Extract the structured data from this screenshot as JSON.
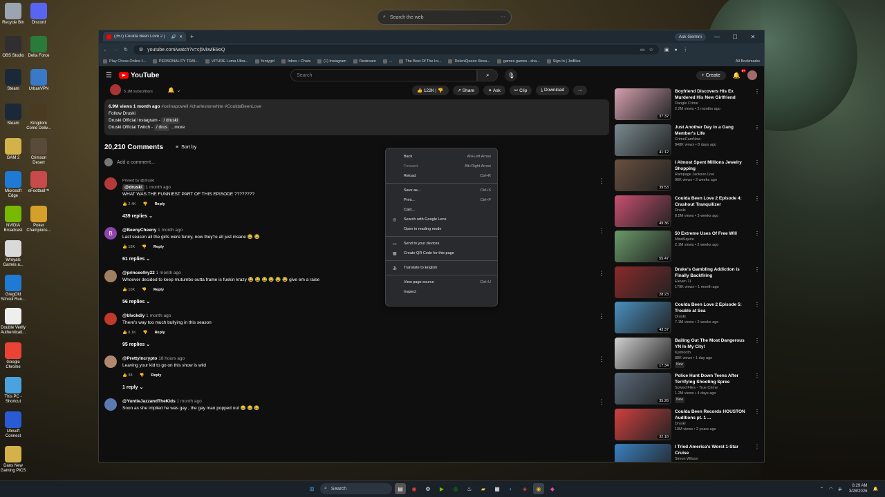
{
  "desktop": {
    "icons": [
      {
        "label": "Recycle Bin",
        "color": "#9aa5b1"
      },
      {
        "label": "Discord",
        "color": "#5865f2"
      },
      {
        "label": "OBS Studio",
        "color": "#302e31"
      },
      {
        "label": "Delta Force",
        "color": "#2a7a3a"
      },
      {
        "label": "Steam",
        "color": "#1b2838"
      },
      {
        "label": "UrbanVPN",
        "color": "#3a78c8"
      },
      {
        "label": "Steam",
        "color": "#1b2838"
      },
      {
        "label": "Kingdom Come Deliv...",
        "color": "#4a3a22"
      },
      {
        "label": "GAM 2",
        "color": "#d4b24a"
      },
      {
        "label": "Crimson Desert",
        "color": "#5a4a3a"
      },
      {
        "label": "Microsoft Edge",
        "color": "#1f7ad6"
      },
      {
        "label": "eFootball™",
        "color": "#c84a4a"
      },
      {
        "label": "NVIDIA Broadcast",
        "color": "#76b900"
      },
      {
        "label": "Poker Champions...",
        "color": "#d4a02a"
      },
      {
        "label": "Wroyals Games a...",
        "color": "#d9d9d9"
      },
      {
        "label": "GregOld School Run...",
        "color": "#1f7ad6"
      },
      {
        "label": "Double Verify Authenticati...",
        "color": "#eeeeee"
      },
      {
        "label": "Google Chrome",
        "color": "#ea4335"
      },
      {
        "label": "This PC - Shortcut",
        "color": "#4aa3df"
      },
      {
        "label": "Ubisoft Connect",
        "color": "#2a5bd7"
      },
      {
        "label": "Dans New Gaming PICS",
        "color": "#d4b24a"
      }
    ],
    "search_placeholder": "Search the web"
  },
  "browser": {
    "tab_title": "(357) Coulda Been Love 2 |",
    "ask_gemini": "Ask Gemini",
    "url": "youtube.com/watch?v=cj5vkwlE9oQ",
    "bookmarks": [
      "Play Chess Online f...",
      "PERSONALITY TRAI...",
      "VITURE Luma Ultra...",
      "fentygirl",
      "Inbox • Chats",
      "(1) Instagram",
      "Restream",
      "...",
      "The Best Of The Ini...",
      "DeleniQueen Strea...",
      "games games - sha...",
      "Sign In | JetBlue"
    ],
    "all_bookmarks": "All Bookmarks"
  },
  "youtube": {
    "logo": "YouTube",
    "search_placeholder": "Search",
    "create": "Create",
    "notif_count": "9+",
    "channel_subs": "5.1M subscribers",
    "like_count": "122K",
    "actions": {
      "share": "Share",
      "ask": "Ask",
      "clip": "Clip",
      "download": "Download"
    },
    "description": {
      "views": "6.9M views",
      "age": "1 month ago",
      "tags": "#celinapowell #charlestonwhite #CouldaBeenLove",
      "line1": "Follow Druski",
      "line2": "Druski Official Instagram -",
      "line2_link": "/ druski",
      "line3": "Druski Official Twitch -",
      "line3_link": "/ drus",
      "more": "...more"
    },
    "comments_count": "20,210 Comments",
    "sort_by": "Sort by",
    "add_comment": "Add a comment...",
    "comments": [
      {
        "pinned": "Pinned by @druski",
        "handle": "@druski",
        "time": "1 month ago",
        "text": "WHAT WAS THE FUNNIEST PART OF THIS EPISODE ????????",
        "likes": "2.4K",
        "reply": "Reply",
        "replies": "439 replies",
        "color": "#b33a3a"
      },
      {
        "handle": "@BeenyCheeny",
        "time": "1 month ago",
        "text": "Last season all the girls were funny, now they're all just insane 😂 😂",
        "likes": "18K",
        "reply": "Reply",
        "replies": "61 replies",
        "color": "#8e44ad",
        "initial": "B"
      },
      {
        "handle": "@princeofny22",
        "time": "1 month ago",
        "text": "Whoever decided to keep mutumbo outta frame is fuxkin krazy 😂 😂 😂 😂 😂 😂 give em a raise",
        "likes": "10K",
        "reply": "Reply",
        "replies": "56 replies",
        "color": "#a08060"
      },
      {
        "handle": "@blvckdiy",
        "time": "1 month ago",
        "text": "There's way too much bullying in this season",
        "likes": "8.1K",
        "reply": "Reply",
        "replies": "95 replies",
        "color": "#c0392b"
      },
      {
        "handle": "@PrettyIncrypto",
        "time": "18 hours ago",
        "text": "Leaving your kid to go on this show is wild",
        "likes": "38",
        "reply": "Reply",
        "replies": "1 reply",
        "color": "#b08870"
      },
      {
        "handle": "@YuntieJazzandTheKids",
        "time": "1 month ago",
        "text": "Soon as she implied he was gay , the gay man popped out 😂 😂 😂",
        "likes": "",
        "reply": "",
        "replies": "",
        "color": "#5a7ab0"
      }
    ],
    "recommendations": [
      {
        "title": "Boyfriend Discovers His Ex Murdered His New Girlfriend",
        "channel": "Dangle Crime",
        "stats": "2.2M views • 2 months ago",
        "duration": "37:32",
        "color": "#d4a0b0"
      },
      {
        "title": "Just Another Day in a Gang Member's Life",
        "channel": "CrimeCamNow",
        "stats": "848K views • 8 days ago",
        "duration": "41:12",
        "color": "#7a8a90"
      },
      {
        "title": "I Almost Spent Millions Jewelry Shopping",
        "channel": "Rampage Jackson Live",
        "stats": "96K views • 2 weeks ago",
        "duration": "39:53",
        "color": "#6a5040"
      },
      {
        "title": "Coulda Been Love 2 Episode 4: Crashout Tranquilizer",
        "channel": "Druski",
        "stats": "8.5M views • 3 weeks ago",
        "duration": "49:36",
        "color": "#c85070"
      },
      {
        "title": "50 Extreme Uses Of Free Will",
        "channel": "MindSquire",
        "stats": "2.1M views • 2 weeks ago",
        "duration": "55:47",
        "color": "#6a9a6a"
      },
      {
        "title": "Drake's Gambling Addiction is Finally Backfiring",
        "channel": "Eleven 11",
        "stats": "179K views • 1 month ago",
        "duration": "28:23",
        "color": "#8a2a2a"
      },
      {
        "title": "Coulda Been Love 2 Episode 5: Trouble at Sea",
        "channel": "Druski",
        "stats": "7.1M views • 2 weeks ago",
        "duration": "43:37",
        "color": "#4a90c0"
      },
      {
        "title": "Bailing Out The Most Dangerous YN In My City!",
        "channel": "Kjsmooth",
        "stats": "88K views • 1 day ago",
        "duration": "17:34",
        "new": "New",
        "color": "#d0d0d0"
      },
      {
        "title": "Police Hunt Down Teens After Terrifying Shooting Spree",
        "channel": "Solved Files - True Crime",
        "stats": "1.2M views • 4 days ago",
        "duration": "35:26",
        "new": "New",
        "color": "#5a6a7a"
      },
      {
        "title": "Coulda Been Records HOUSTON Auditions pt. 1 ...",
        "channel": "Druski",
        "stats": "10M views • 2 years ago",
        "duration": "32:18",
        "color": "#d04040"
      },
      {
        "title": "I Tried America's Worst 1-Star Cruise",
        "channel": "Simon Wilson",
        "stats": "",
        "duration": "",
        "color": "#3a80c0"
      }
    ]
  },
  "context_menu": [
    {
      "label": "Back",
      "shortcut": "Alt+Left Arrow",
      "disabled": false
    },
    {
      "label": "Forward",
      "shortcut": "Alt+Right Arrow",
      "disabled": true
    },
    {
      "label": "Reload",
      "shortcut": "Ctrl+R",
      "disabled": false
    },
    {
      "sep": true
    },
    {
      "label": "Save as...",
      "shortcut": "Ctrl+S",
      "disabled": false
    },
    {
      "label": "Print...",
      "shortcut": "Ctrl+P",
      "disabled": false
    },
    {
      "label": "Cast...",
      "shortcut": "",
      "disabled": false
    },
    {
      "label": "Search with Google Lens",
      "shortcut": "",
      "icon": "lens-icon",
      "disabled": false
    },
    {
      "label": "Open in reading mode",
      "shortcut": "",
      "disabled": false
    },
    {
      "sep": true
    },
    {
      "label": "Send to your devices",
      "shortcut": "",
      "icon": "devices-icon",
      "disabled": false
    },
    {
      "label": "Create QR Code for this page",
      "shortcut": "",
      "icon": "qr-icon",
      "disabled": false
    },
    {
      "sep": true
    },
    {
      "label": "Translate to English",
      "shortcut": "",
      "icon": "translate-icon",
      "disabled": false
    },
    {
      "sep": true
    },
    {
      "label": "View page source",
      "shortcut": "Ctrl+U",
      "disabled": false
    },
    {
      "label": "Inspect",
      "shortcut": "",
      "disabled": false
    }
  ],
  "taskbar": {
    "search": "Search",
    "time": "8:29 AM",
    "date": "3/28/2026"
  }
}
